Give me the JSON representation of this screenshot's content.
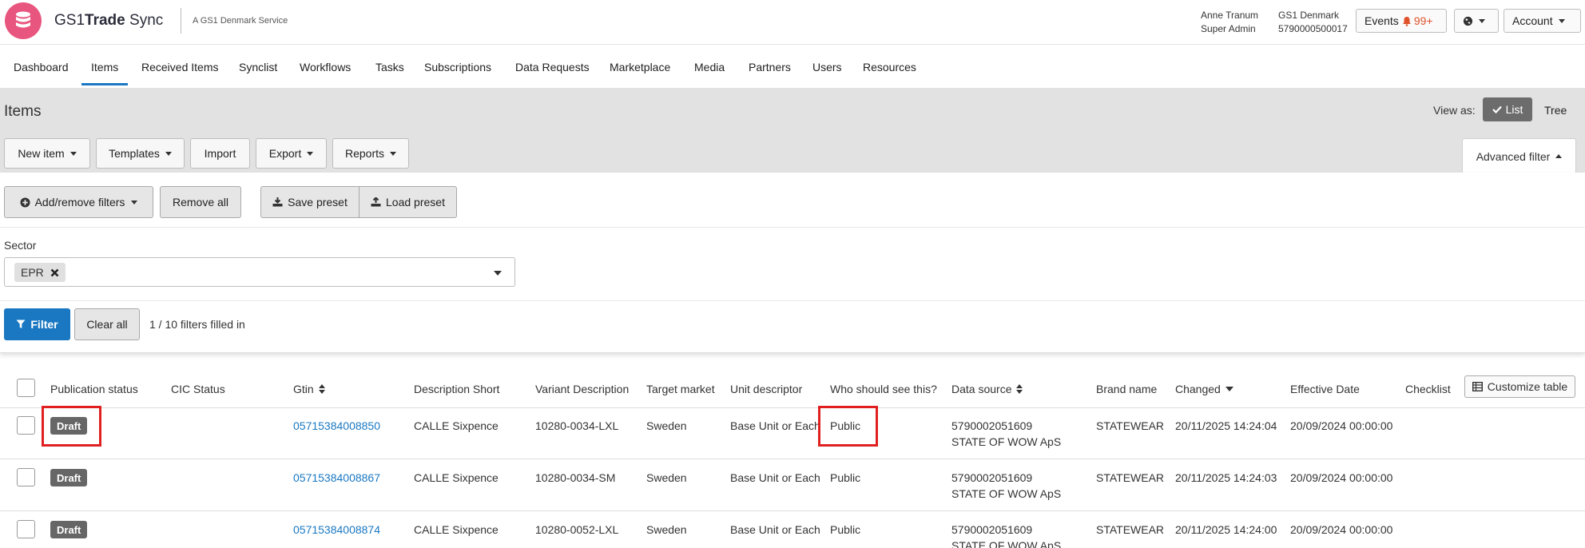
{
  "header": {
    "brand_prefix": "GS1",
    "brand_bold": "Trade",
    "brand_suffix": "Sync",
    "brand_sub": "A GS1 Denmark Service",
    "user_name": "Anne Tranum",
    "user_role": "Super Admin",
    "org_name": "GS1 Denmark",
    "org_gln": "5790000500017",
    "events_label": "Events",
    "events_count": "99+",
    "account_label": "Account",
    "colors": {
      "logo": "#e8567f",
      "accent": "#1a78c2",
      "events_count": "#e0522a"
    }
  },
  "nav": {
    "items": [
      "Dashboard",
      "Items",
      "Received Items",
      "Synclist",
      "Workflows",
      "Tasks",
      "Subscriptions",
      "Data Requests",
      "Marketplace",
      "Media",
      "Partners",
      "Users",
      "Resources"
    ],
    "active": "Items"
  },
  "page": {
    "title": "Items",
    "view_as_label": "View as:",
    "view_list": "List",
    "view_tree": "Tree",
    "toolbar": {
      "new_item": "New item",
      "templates": "Templates",
      "import": "Import",
      "export": "Export",
      "reports": "Reports",
      "advanced_filter": "Advanced filter"
    }
  },
  "filters": {
    "add_remove": "Add/remove filters",
    "remove_all": "Remove all",
    "save_preset": "Save preset",
    "load_preset": "Load preset",
    "sector_label": "Sector",
    "sector_tag": "EPR",
    "filter_btn": "Filter",
    "clear_all": "Clear all",
    "filled_text": "1 / 10 filters filled in"
  },
  "table": {
    "headers": {
      "publication_status": "Publication status",
      "cic_status": "CIC Status",
      "gtin": "Gtin",
      "description_short": "Description Short",
      "variant_description": "Variant Description",
      "target_market": "Target market",
      "unit_descriptor": "Unit descriptor",
      "who_should_see": "Who should see this?",
      "data_source": "Data source",
      "brand_name": "Brand name",
      "changed": "Changed",
      "effective_date": "Effective Date",
      "checklist": "Checklist"
    },
    "customize_label": "Customize table",
    "rows": [
      {
        "status": "Draft",
        "gtin": "05715384008850",
        "description": "CALLE Sixpence",
        "variant": "10280-0034-LXL",
        "market": "Sweden",
        "unit": "Base Unit or Each",
        "visibility": "Public",
        "source_gln": "5790002051609",
        "source_name": "STATE OF WOW ApS",
        "brand": "STATEWEAR",
        "changed": "20/11/2025 14:24:04",
        "effective": "20/09/2024 00:00:00"
      },
      {
        "status": "Draft",
        "gtin": "05715384008867",
        "description": "CALLE Sixpence",
        "variant": "10280-0034-SM",
        "market": "Sweden",
        "unit": "Base Unit or Each",
        "visibility": "Public",
        "source_gln": "5790002051609",
        "source_name": "STATE OF WOW ApS",
        "brand": "STATEWEAR",
        "changed": "20/11/2025 14:24:03",
        "effective": "20/09/2024 00:00:00"
      },
      {
        "status": "Draft",
        "gtin": "05715384008874",
        "description": "CALLE Sixpence",
        "variant": "10280-0052-LXL",
        "market": "Sweden",
        "unit": "Base Unit or Each",
        "visibility": "Public",
        "source_gln": "5790002051609",
        "source_name": "STATE OF WOW ApS",
        "brand": "STATEWEAR",
        "changed": "20/11/2025 14:24:00",
        "effective": "20/09/2024 00:00:00"
      }
    ]
  }
}
